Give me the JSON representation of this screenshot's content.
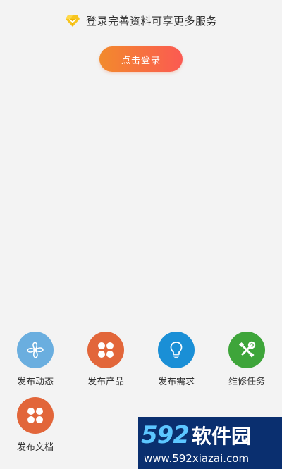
{
  "promo": {
    "icon": "diamond-icon",
    "text": "登录完善资料可享更多服务"
  },
  "login": {
    "label": "点击登录",
    "gradient": [
      "#f28a2c",
      "#fb5a52"
    ]
  },
  "actions": [
    {
      "label": "发布动态",
      "icon": "fan-icon",
      "color": "#6aaedf"
    },
    {
      "label": "发布产品",
      "icon": "four-petal-icon",
      "color": "#e2663a"
    },
    {
      "label": "发布需求",
      "icon": "lightbulb-icon",
      "color": "#1a8fd6"
    },
    {
      "label": "维修任务",
      "icon": "wrench-screwdriver-icon",
      "color": "#3ea53a"
    },
    {
      "label": "发布文档",
      "icon": "four-petal-icon",
      "color": "#e2663a"
    }
  ],
  "watermark": {
    "number": "592",
    "name": "软件园",
    "url": "www.592xiazai.com"
  }
}
